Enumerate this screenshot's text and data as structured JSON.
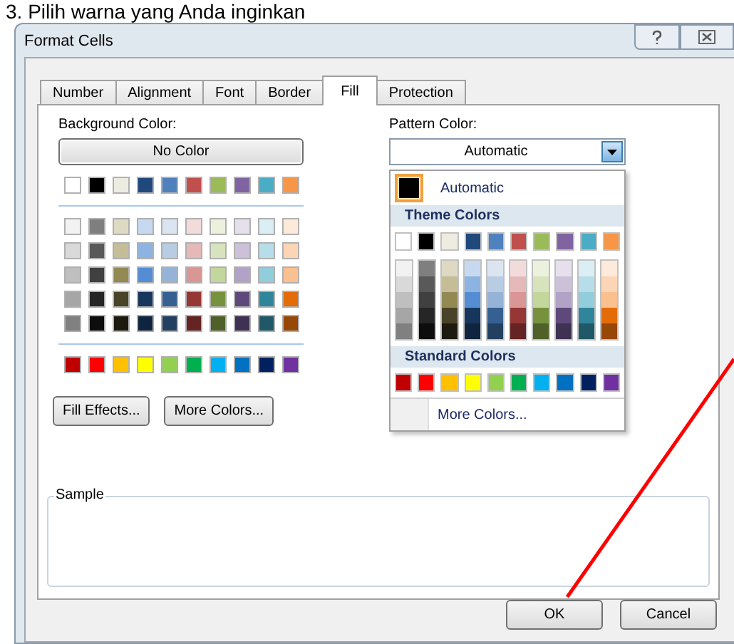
{
  "heading": "3. Pilih warna yang Anda inginkan",
  "window": {
    "title": "Format Cells"
  },
  "tabs": [
    {
      "label": "Number",
      "selected": false
    },
    {
      "label": "Alignment",
      "selected": false
    },
    {
      "label": "Font",
      "selected": false
    },
    {
      "label": "Border",
      "selected": false
    },
    {
      "label": "Fill",
      "selected": true
    },
    {
      "label": "Protection",
      "selected": false
    }
  ],
  "background": {
    "label": "Background Color:",
    "no_color_button": "No Color",
    "theme_colors": [
      {
        "color": "#ffffff",
        "shades": [
          {
            "color": "#f2f2f2"
          },
          {
            "color": "#d9d9d9"
          },
          {
            "color": "#bfbfbf"
          },
          {
            "color": "#a6a6a6"
          },
          {
            "color": "#808080"
          }
        ]
      },
      {
        "color": "#000000",
        "shades": [
          {
            "color": "#7f7f7f"
          },
          {
            "color": "#595959"
          },
          {
            "color": "#404040"
          },
          {
            "color": "#262626"
          },
          {
            "color": "#0d0d0d"
          }
        ]
      },
      {
        "color": "#eeece1",
        "shades": [
          {
            "color": "#ddd9c3"
          },
          {
            "color": "#c4bd97"
          },
          {
            "color": "#938953"
          },
          {
            "color": "#494429"
          },
          {
            "color": "#1d1b10"
          }
        ]
      },
      {
        "color": "#1f497d",
        "shades": [
          {
            "color": "#c6d9f0"
          },
          {
            "color": "#8db3e2"
          },
          {
            "color": "#548dd4"
          },
          {
            "color": "#17365d"
          },
          {
            "color": "#0f243e"
          }
        ]
      },
      {
        "color": "#4f81bd",
        "shades": [
          {
            "color": "#dbe5f1"
          },
          {
            "color": "#b8cce4"
          },
          {
            "color": "#95b3d7"
          },
          {
            "color": "#366092"
          },
          {
            "color": "#244061"
          }
        ]
      },
      {
        "color": "#c0504d",
        "shades": [
          {
            "color": "#f2dcdb"
          },
          {
            "color": "#e5b9b7"
          },
          {
            "color": "#d99694"
          },
          {
            "color": "#953734"
          },
          {
            "color": "#632423"
          }
        ]
      },
      {
        "color": "#9bbb59",
        "shades": [
          {
            "color": "#ebf1dd"
          },
          {
            "color": "#d7e3bc"
          },
          {
            "color": "#c3d69b"
          },
          {
            "color": "#76923c"
          },
          {
            "color": "#4f6128"
          }
        ]
      },
      {
        "color": "#8064a2",
        "shades": [
          {
            "color": "#e5e0ec"
          },
          {
            "color": "#ccc1d9"
          },
          {
            "color": "#b2a2c7"
          },
          {
            "color": "#5f497a"
          },
          {
            "color": "#3f3151"
          }
        ]
      },
      {
        "color": "#4bacc6",
        "shades": [
          {
            "color": "#dbeef3"
          },
          {
            "color": "#b7dde8"
          },
          {
            "color": "#92cddc"
          },
          {
            "color": "#31859b"
          },
          {
            "color": "#205867"
          }
        ]
      },
      {
        "color": "#f79646",
        "shades": [
          {
            "color": "#fdeada"
          },
          {
            "color": "#fbd5b5"
          },
          {
            "color": "#fac08f"
          },
          {
            "color": "#e36c09"
          },
          {
            "color": "#974806"
          }
        ]
      }
    ],
    "standard_colors": [
      {
        "color": "#c00000"
      },
      {
        "color": "#ff0000"
      },
      {
        "color": "#ffc000"
      },
      {
        "color": "#ffff00"
      },
      {
        "color": "#92d050"
      },
      {
        "color": "#00b050"
      },
      {
        "color": "#00b0f0"
      },
      {
        "color": "#0070c0"
      },
      {
        "color": "#002060"
      },
      {
        "color": "#7030a0"
      }
    ],
    "buttons": [
      "Fill Effects...",
      "More Colors..."
    ]
  },
  "pattern": {
    "label": "Pattern Color:",
    "value": "Automatic",
    "menu": {
      "automatic": {
        "label": "Automatic",
        "color": "#000000",
        "selected": true
      },
      "theme_header": "Theme Colors",
      "theme_colors": [
        {
          "color": "#ffffff",
          "shades": [
            {
              "color": "#f2f2f2"
            },
            {
              "color": "#d9d9d9"
            },
            {
              "color": "#bfbfbf"
            },
            {
              "color": "#a6a6a6"
            },
            {
              "color": "#808080"
            }
          ]
        },
        {
          "color": "#000000",
          "shades": [
            {
              "color": "#7f7f7f"
            },
            {
              "color": "#595959"
            },
            {
              "color": "#404040"
            },
            {
              "color": "#262626"
            },
            {
              "color": "#0d0d0d"
            }
          ]
        },
        {
          "color": "#eeece1",
          "shades": [
            {
              "color": "#ddd9c3"
            },
            {
              "color": "#c4bd97"
            },
            {
              "color": "#938953"
            },
            {
              "color": "#494429"
            },
            {
              "color": "#1d1b10"
            }
          ]
        },
        {
          "color": "#1f497d",
          "shades": [
            {
              "color": "#c6d9f0"
            },
            {
              "color": "#8db3e2"
            },
            {
              "color": "#548dd4"
            },
            {
              "color": "#17365d"
            },
            {
              "color": "#0f243e"
            }
          ]
        },
        {
          "color": "#4f81bd",
          "shades": [
            {
              "color": "#dbe5f1"
            },
            {
              "color": "#b8cce4"
            },
            {
              "color": "#95b3d7"
            },
            {
              "color": "#366092"
            },
            {
              "color": "#244061"
            }
          ]
        },
        {
          "color": "#c0504d",
          "shades": [
            {
              "color": "#f2dcdb"
            },
            {
              "color": "#e5b9b7"
            },
            {
              "color": "#d99694"
            },
            {
              "color": "#953734"
            },
            {
              "color": "#632423"
            }
          ]
        },
        {
          "color": "#9bbb59",
          "shades": [
            {
              "color": "#ebf1dd"
            },
            {
              "color": "#d7e3bc"
            },
            {
              "color": "#c3d69b"
            },
            {
              "color": "#76923c"
            },
            {
              "color": "#4f6128"
            }
          ]
        },
        {
          "color": "#8064a2",
          "shades": [
            {
              "color": "#e5e0ec"
            },
            {
              "color": "#ccc1d9"
            },
            {
              "color": "#b2a2c7"
            },
            {
              "color": "#5f497a"
            },
            {
              "color": "#3f3151"
            }
          ]
        },
        {
          "color": "#4bacc6",
          "shades": [
            {
              "color": "#dbeef3"
            },
            {
              "color": "#b7dde8"
            },
            {
              "color": "#92cddc"
            },
            {
              "color": "#31859b"
            },
            {
              "color": "#205867"
            }
          ]
        },
        {
          "color": "#f79646",
          "shades": [
            {
              "color": "#fdeada"
            },
            {
              "color": "#fbd5b5"
            },
            {
              "color": "#fac08f"
            },
            {
              "color": "#e36c09"
            },
            {
              "color": "#974806"
            }
          ]
        }
      ],
      "standard_header": "Standard Colors",
      "standard_colors": [
        {
          "color": "#c00000"
        },
        {
          "color": "#ff0000"
        },
        {
          "color": "#ffc000"
        },
        {
          "color": "#ffff00"
        },
        {
          "color": "#92d050"
        },
        {
          "color": "#00b050"
        },
        {
          "color": "#00b0f0"
        },
        {
          "color": "#0070c0"
        },
        {
          "color": "#002060"
        },
        {
          "color": "#7030a0"
        }
      ],
      "more_colors": "More Colors..."
    }
  },
  "sample": {
    "label": "Sample"
  },
  "footer_buttons": [
    "OK",
    "Cancel"
  ]
}
